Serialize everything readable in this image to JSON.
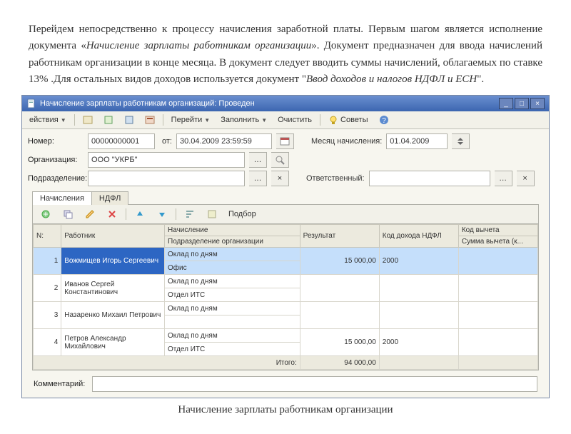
{
  "doc_text": {
    "p1a": "Перейдем непосредственно к процессу начисления заработной платы. Первым шагом является исполнение документа «",
    "p1b": "Начисление зарплаты работникам организации",
    "p1c": "». Документ предназначен для ввода начислений работникам организации в конце месяца. В документ следует вводить суммы начислений, облагаемых по ставке 13% .Для остальных видов доходов используется документ \"",
    "p1d": "Ввод доходов и налогов НДФЛ и ЕСН",
    "p1e": "\"."
  },
  "window": {
    "title": "Начисление зарплаты работникам организаций: Проведен"
  },
  "toolbar": {
    "actions": "ействия",
    "go": "Перейти",
    "fill": "Заполнить",
    "clear": "Очистить",
    "tips": "Советы"
  },
  "form": {
    "number_label": "Номер:",
    "number": "00000000001",
    "from": "от:",
    "date": "30.04.2009 23:59:59",
    "month_label": "Месяц начисления:",
    "month": "01.04.2009",
    "org_label": "Организация:",
    "org": "ООО \"УКРБ\"",
    "dept_label": "Подразделение:",
    "resp_label": "Ответственный:",
    "comment_label": "Комментарий:"
  },
  "tabs": {
    "t1": "Начисления",
    "t2": "НДФЛ"
  },
  "grid_toolbar": {
    "select": "Подбор"
  },
  "grid": {
    "headers": {
      "num": "N:",
      "worker": "Работник",
      "calc": "Начисление",
      "dept": "Подразделение организации",
      "result": "Результат",
      "ndfl_code": "Код дохода НДФЛ",
      "ded_code": "Код вычета",
      "ded_sum": "Сумма вычета (к..."
    },
    "rows": [
      {
        "n": "1",
        "worker": "Вожмищев Игорь Сергеевич",
        "calc": "Оклад по дням",
        "dept": "Офис",
        "result": "15 000,00",
        "ndfl": "2000"
      },
      {
        "n": "2",
        "worker": "Иванов Сергей Константинович",
        "calc": "Оклад по дням",
        "dept": "Отдел ИТС",
        "result": "",
        "ndfl": ""
      },
      {
        "n": "3",
        "worker": "Назаренко Михаил Петрович",
        "calc": "Оклад по дням",
        "dept": "",
        "result": "",
        "ndfl": ""
      },
      {
        "n": "4",
        "worker": "Петров Александр Михайлович",
        "calc": "Оклад по дням",
        "dept": "Отдел ИТС",
        "result": "15 000,00",
        "ndfl": "2000"
      }
    ],
    "total_label": "Итого:",
    "total": "94 000,00"
  },
  "caption": "Начисление зарплаты работникам организации"
}
